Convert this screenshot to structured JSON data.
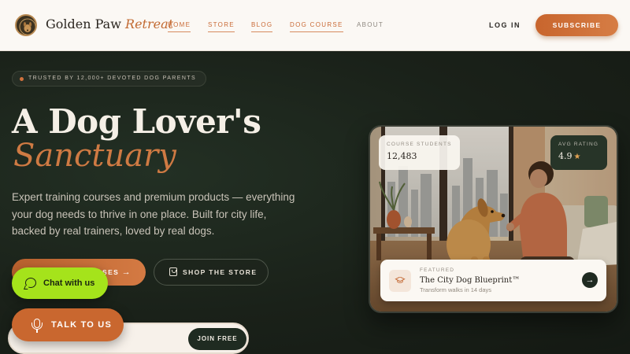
{
  "header": {
    "brand_regular": "Golden Paw",
    "brand_italic": "Retreat",
    "nav": [
      {
        "label": "HOME",
        "active": true
      },
      {
        "label": "STORE",
        "active": false
      },
      {
        "label": "BLOG",
        "active": false
      },
      {
        "label": "DOG COURSE",
        "active": false
      },
      {
        "label": "ABOUT",
        "active": false
      }
    ],
    "login_label": "LOG IN",
    "subscribe_label": "SUBSCRIBE"
  },
  "hero": {
    "trust_badge": "TRUSTED BY 12,000+ DEVOTED DOG PARENTS",
    "headline_line1": "A Dog Lover's",
    "headline_line2": "Sanctuary",
    "lead": "Expert training courses and premium products — everything your dog needs to thrive in one place. Built for city life, backed by real trainers, loved by real dogs.",
    "primary_cta_label": "SES",
    "primary_cta_icon": "arrow-right-icon",
    "secondary_cta_label": "SHOP THE STORE",
    "secondary_cta_icon": "shopping-bag-icon",
    "join_free_label": "JOIN FREE"
  },
  "widgets": {
    "chat_label": "Chat with us",
    "talk_label": "TALK TO US"
  },
  "card": {
    "students_label": "COURSE STUDENTS",
    "students_value": "12,483",
    "rating_label": "AVG RATING",
    "rating_value": "4.9",
    "rating_star": "★",
    "featured_kicker": "FEATURED",
    "featured_title": "The City Dog Blueprint™",
    "featured_subtitle": "Transform walks in 14 days",
    "featured_icon": "graduation-cap-icon"
  },
  "colors": {
    "accent": "#c96a36",
    "hero_bg": "#1b2119",
    "chat_green": "#a5e31b"
  }
}
